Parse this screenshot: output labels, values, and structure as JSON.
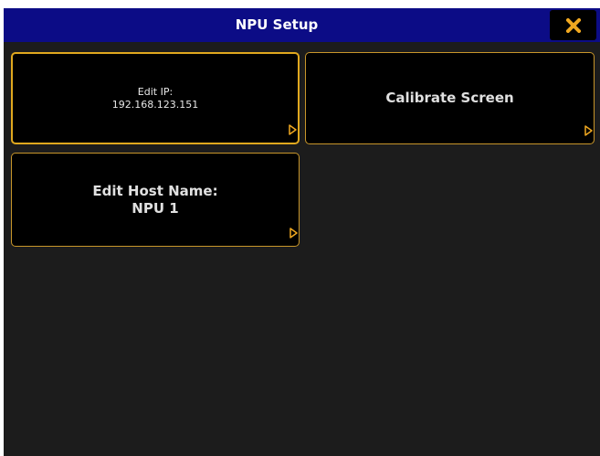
{
  "header": {
    "title": "NPU Setup",
    "close_icon": "close-x-icon"
  },
  "colors": {
    "titlebar": "#0c0c86",
    "background": "#1c1c1c",
    "tile": "#000000",
    "tile_border": "#e0a81e",
    "close_icon": "#f0a820"
  },
  "tiles": {
    "edit_ip": {
      "label": "Edit IP:",
      "value": "192.168.123.151",
      "icon": "submenu-arrow-icon"
    },
    "calibrate": {
      "label": "Calibrate Screen",
      "icon": "submenu-arrow-icon"
    },
    "host_name": {
      "label": "Edit Host Name:",
      "value": "NPU 1",
      "icon": "submenu-arrow-icon"
    }
  }
}
